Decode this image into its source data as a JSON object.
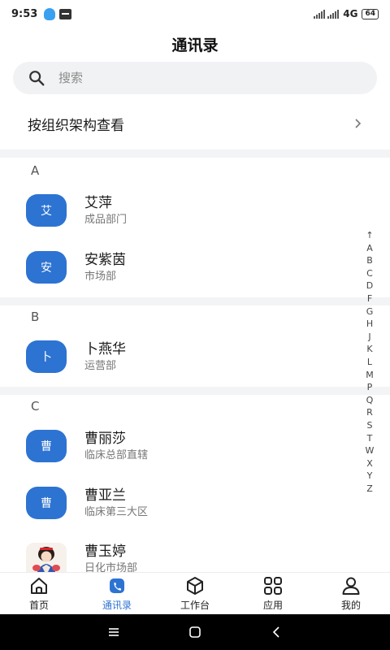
{
  "status": {
    "time": "9:53",
    "network": "4G",
    "battery": "64"
  },
  "header": {
    "title": "通讯录"
  },
  "search": {
    "placeholder": "搜索"
  },
  "org": {
    "label": "按组织架构查看"
  },
  "sections": [
    {
      "letter": "A",
      "contacts": [
        {
          "avatar": "艾",
          "name": "艾萍",
          "dept": "成品部门"
        },
        {
          "avatar": "安",
          "name": "安紫茵",
          "dept": "市场部"
        }
      ]
    },
    {
      "letter": "B",
      "contacts": [
        {
          "avatar": "卜",
          "name": "卜燕华",
          "dept": "运营部"
        }
      ]
    },
    {
      "letter": "C",
      "contacts": [
        {
          "avatar": "曹",
          "name": "曹丽莎",
          "dept": "临床总部直辖"
        },
        {
          "avatar": "曹",
          "name": "曹亚兰",
          "dept": "临床第三大区"
        },
        {
          "avatar": "",
          "name": "曹玉婷",
          "dept": "日化市场部"
        }
      ]
    }
  ],
  "index": [
    "↑",
    "A",
    "B",
    "C",
    "D",
    "F",
    "G",
    "H",
    "J",
    "K",
    "L",
    "M",
    "P",
    "Q",
    "R",
    "S",
    "T",
    "W",
    "X",
    "Y",
    "Z"
  ],
  "tabs": [
    {
      "label": "首页",
      "icon": "home-icon",
      "active": false
    },
    {
      "label": "通讯录",
      "icon": "contacts-phone-icon",
      "active": true
    },
    {
      "label": "工作台",
      "icon": "workbench-cube-icon",
      "active": false
    },
    {
      "label": "应用",
      "icon": "apps-grid-icon",
      "active": false
    },
    {
      "label": "我的",
      "icon": "profile-icon",
      "active": false
    }
  ],
  "colors": {
    "accent": "#2d73d2",
    "search_bg": "#f1f2f4",
    "divider": "#f3f4f6"
  }
}
